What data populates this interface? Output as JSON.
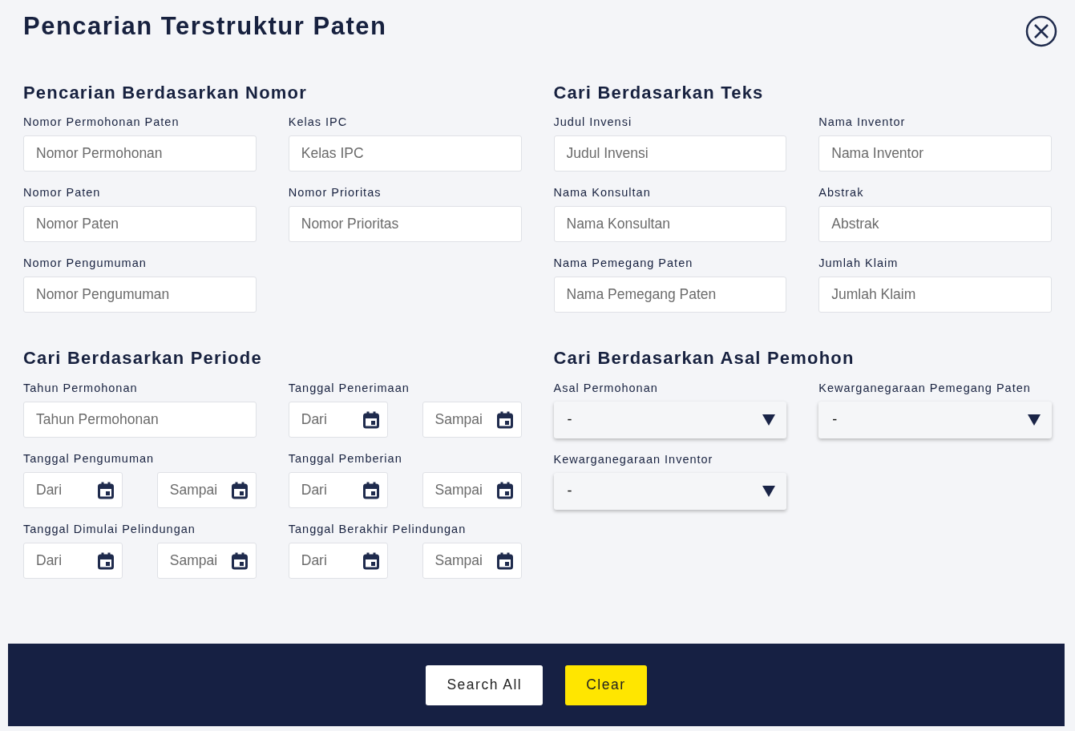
{
  "title": "Pencarian Terstruktur Paten",
  "sections": [
    {
      "title": "Pencarian Berdasarkan Nomor",
      "fields": [
        {
          "kind": "text",
          "label": "Nomor Permohonan Paten",
          "placeholder": "Nomor Permohonan"
        },
        {
          "kind": "text",
          "label": "Kelas IPC",
          "placeholder": "Kelas IPC"
        },
        {
          "kind": "text",
          "label": "Nomor Paten",
          "placeholder": "Nomor Paten"
        },
        {
          "kind": "text",
          "label": "Nomor Prioritas",
          "placeholder": "Nomor Prioritas"
        },
        {
          "kind": "text",
          "label": "Nomor Pengumuman",
          "placeholder": "Nomor Pengumuman"
        }
      ]
    },
    {
      "title": "Cari Berdasarkan Teks",
      "fields": [
        {
          "kind": "text",
          "label": "Judul Invensi",
          "placeholder": "Judul Invensi"
        },
        {
          "kind": "text",
          "label": "Nama Inventor",
          "placeholder": "Nama Inventor"
        },
        {
          "kind": "text",
          "label": "Nama Konsultan",
          "placeholder": "Nama Konsultan"
        },
        {
          "kind": "text",
          "label": "Abstrak",
          "placeholder": "Abstrak"
        },
        {
          "kind": "text",
          "label": "Nama Pemegang Paten",
          "placeholder": "Nama Pemegang Paten"
        },
        {
          "kind": "text",
          "label": "Jumlah Klaim",
          "placeholder": "Jumlah Klaim"
        }
      ]
    },
    {
      "title": "Cari Berdasarkan Periode",
      "fields": [
        {
          "kind": "text",
          "label": "Tahun Permohonan",
          "placeholder": "Tahun Permohonan"
        },
        {
          "kind": "range",
          "label": "Tanggal Penerimaan",
          "from_placeholder": "Dari",
          "to_placeholder": "Sampai"
        },
        {
          "kind": "range",
          "label": "Tanggal Pengumuman",
          "from_placeholder": "Dari",
          "to_placeholder": "Sampai"
        },
        {
          "kind": "range",
          "label": "Tanggal Pemberian",
          "from_placeholder": "Dari",
          "to_placeholder": "Sampai"
        },
        {
          "kind": "range",
          "label": "Tanggal Dimulai Pelindungan",
          "from_placeholder": "Dari",
          "to_placeholder": "Sampai"
        },
        {
          "kind": "range",
          "label": "Tanggal Berakhir Pelindungan",
          "from_placeholder": "Dari",
          "to_placeholder": "Sampai"
        }
      ]
    },
    {
      "title": "Cari Berdasarkan Asal Pemohon",
      "fields": [
        {
          "kind": "select",
          "label": "Asal Permohonan",
          "value": "-"
        },
        {
          "kind": "select",
          "label": "Kewarganegaraan Pemegang Paten",
          "value": "-"
        },
        {
          "kind": "select",
          "label": "Kewarganegaraan Inventor",
          "value": "-"
        }
      ]
    }
  ],
  "buttons": [
    {
      "kind": "primary",
      "label": "Search All"
    },
    {
      "kind": "warning",
      "label": "Clear"
    }
  ]
}
